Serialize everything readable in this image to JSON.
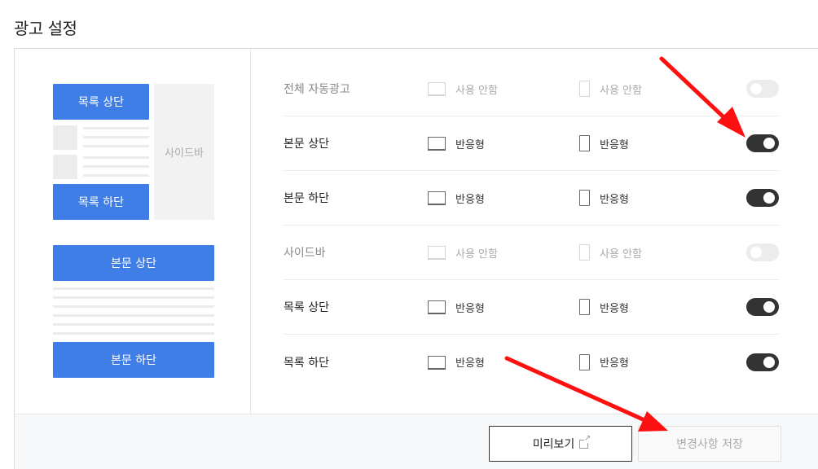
{
  "page": {
    "title": "광고 설정"
  },
  "preview": {
    "list_top": "목록 상단",
    "list_bottom": "목록 하단",
    "sidebar": "사이드바",
    "body_top": "본문 상단",
    "body_bottom": "본문 하단"
  },
  "settings": {
    "rows": [
      {
        "label": "전체 자동광고",
        "pc": "사용 안함",
        "mobile": "사용 안함",
        "enabled": false,
        "disabled": true
      },
      {
        "label": "본문 상단",
        "pc": "반응형",
        "mobile": "반응형",
        "enabled": true,
        "disabled": false
      },
      {
        "label": "본문 하단",
        "pc": "반응형",
        "mobile": "반응형",
        "enabled": true,
        "disabled": false
      },
      {
        "label": "사이드바",
        "pc": "사용 안함",
        "mobile": "사용 안함",
        "enabled": false,
        "disabled": true
      },
      {
        "label": "목록 상단",
        "pc": "반응형",
        "mobile": "반응형",
        "enabled": true,
        "disabled": false
      },
      {
        "label": "목록 하단",
        "pc": "반응형",
        "mobile": "반응형",
        "enabled": true,
        "disabled": false
      }
    ]
  },
  "footer": {
    "preview_label": "미리보기",
    "save_label": "변경사항 저장"
  },
  "icons": {
    "pc": "desktop-icon",
    "mobile": "mobile-icon",
    "external": "external-link-icon",
    "annotation": "red-arrow"
  },
  "colors": {
    "accent": "#3f7ee6",
    "toggle_on": "#333333",
    "toggle_off": "#ececec",
    "annotation": "#ff1010"
  }
}
